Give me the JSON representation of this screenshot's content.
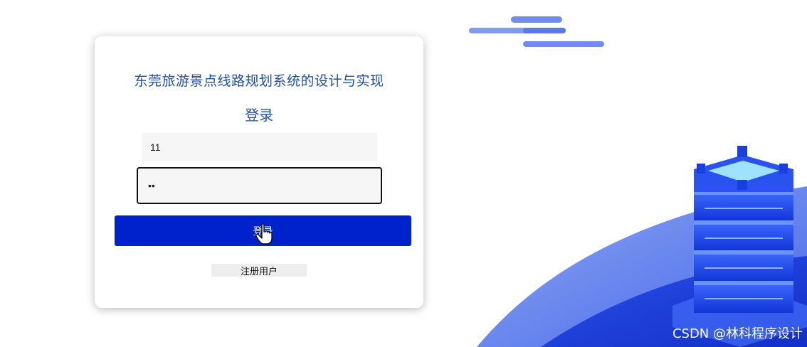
{
  "login_form": {
    "system_title": "东莞旅游景点线路规划系统的设计与实现",
    "heading": "登录",
    "username_value": "11",
    "password_value": "••",
    "login_button_label": "登录",
    "register_button_label": "注册用户"
  },
  "watermark": "CSDN @林科程序设计",
  "colors": {
    "primary_button": "#0022cc",
    "title_text": "#1f4faa",
    "field_background": "#f6f6f6",
    "illustration_blue": "#1a3fe0"
  },
  "icons": {
    "cursor": "hand-pointer-icon",
    "decoration_cloud": "cloud-stripes-icon",
    "decoration_server": "server-stack-icon"
  }
}
